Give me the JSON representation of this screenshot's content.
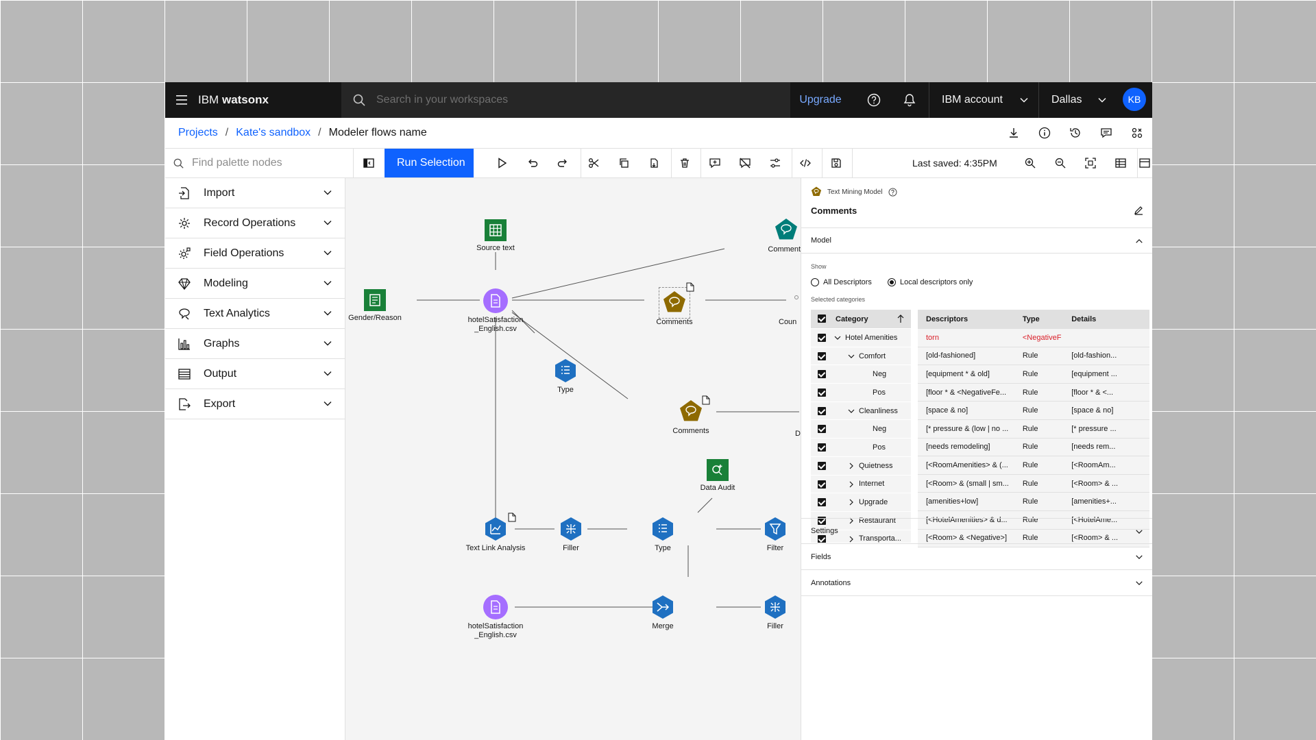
{
  "header": {
    "brand_prefix": "IBM",
    "brand_name": "watsonx",
    "search_placeholder": "Search in your workspaces",
    "upgrade_label": "Upgrade",
    "account_label": "IBM account",
    "region_label": "Dallas",
    "avatar_initials": "KB"
  },
  "breadcrumb": {
    "items": [
      "Projects",
      "Kate's sandbox"
    ],
    "current": "Modeler flows name"
  },
  "toolbar": {
    "palette_search_placeholder": "Find palette nodes",
    "run_selection_label": "Run Selection",
    "last_saved": "Last saved: 4:35PM"
  },
  "palette": {
    "items": [
      {
        "label": "Import",
        "icon": "import-icon"
      },
      {
        "label": "Record Operations",
        "icon": "record-operations-icon"
      },
      {
        "label": "Field Operations",
        "icon": "field-operations-icon"
      },
      {
        "label": "Modeling",
        "icon": "modeling-icon"
      },
      {
        "label": "Text Analytics",
        "icon": "text-analytics-icon"
      },
      {
        "label": "Graphs",
        "icon": "graphs-icon"
      },
      {
        "label": "Output",
        "icon": "output-icon"
      },
      {
        "label": "Export",
        "icon": "export-icon"
      }
    ]
  },
  "canvas": {
    "nodes": {
      "source_text": "Source text",
      "gender_reason": "Gender/Reason",
      "hotel_csv_1_line1": "hotelSatisfaction",
      "hotel_csv_1_line2": "_English.csv",
      "comments_top": "Comments",
      "comments_mid": "Comments",
      "comments_cut": "Coun",
      "type_top": "Type",
      "comments_lower": "Comments",
      "lower_cut": "D",
      "data_audit": "Data Audit",
      "text_link_analysis": "Text Link Analysis",
      "filler_1": "Filler",
      "type_bottom": "Type",
      "filter": "Filter",
      "hotel_csv_2_line1": "hotelSatisfaction",
      "hotel_csv_2_line2": "_English.csv",
      "merge": "Merge",
      "filler_2": "Filler"
    },
    "colors": {
      "green": "#198038",
      "purple": "#a56eff",
      "blue": "#0f62fe",
      "dark_blue": "#1f70c1",
      "teal": "#007d79",
      "gold": "#8e6a00"
    }
  },
  "panel": {
    "node_kind": "Text Mining Model",
    "node_title": "Comments",
    "model_section": "Model",
    "show_label": "Show",
    "radio_all": "All Descriptors",
    "radio_local": "Local descriptors only",
    "selected_categories_label": "Selected categories",
    "tree_header": "Category",
    "tree": [
      {
        "label": "Hotel Amenities",
        "level": 0,
        "chev": "down"
      },
      {
        "label": "Comfort",
        "level": 1,
        "chev": "down"
      },
      {
        "label": "Neg",
        "level": 2,
        "chev": ""
      },
      {
        "label": "Pos",
        "level": 2,
        "chev": ""
      },
      {
        "label": "Cleanliness",
        "level": 1,
        "chev": "down"
      },
      {
        "label": "Neg",
        "level": 2,
        "chev": ""
      },
      {
        "label": "Pos",
        "level": 2,
        "chev": ""
      },
      {
        "label": "Quietness",
        "level": 1,
        "chev": "right"
      },
      {
        "label": "Internet",
        "level": 1,
        "chev": "right"
      },
      {
        "label": "Upgrade",
        "level": 1,
        "chev": "right"
      },
      {
        "label": "Restaurant",
        "level": 1,
        "chev": "right"
      },
      {
        "label": "Transporta...",
        "level": 1,
        "chev": "right"
      }
    ],
    "descriptors_header": {
      "c1": "Descriptors",
      "c2": "Type",
      "c3": "Details"
    },
    "descriptors": [
      {
        "c1": "torn",
        "c2": "<NegativeF",
        "c3": ""
      },
      {
        "c1": "[old-fashioned]",
        "c2": "Rule",
        "c3": "[old-fashion..."
      },
      {
        "c1": "[equipment * & old]",
        "c2": "Rule",
        "c3": "[equipment ..."
      },
      {
        "c1": "[floor * & <NegativeFe...",
        "c2": "Rule",
        "c3": "[floor * & <..."
      },
      {
        "c1": "[space & no]",
        "c2": "Rule",
        "c3": "[space & no]"
      },
      {
        "c1": "[* pressure & (low | no ...",
        "c2": "Rule",
        "c3": "[* pressure ..."
      },
      {
        "c1": "[needs remodeling]",
        "c2": "Rule",
        "c3": "[needs rem..."
      },
      {
        "c1": "[<RoomAmenities> & (...",
        "c2": "Rule",
        "c3": "[<RoomAm..."
      },
      {
        "c1": "[<Room> & (small | sm...",
        "c2": "Rule",
        "c3": "[<Room> & ..."
      },
      {
        "c1": "[amenities+low]",
        "c2": "Rule",
        "c3": "[amenities+..."
      },
      {
        "c1": "[<HotelAmenities> & d...",
        "c2": "Rule",
        "c3": "[<HotelAme..."
      },
      {
        "c1": "[<Room> & <Negative>]",
        "c2": "Rule",
        "c3": "[<Room> & ..."
      }
    ],
    "sections": [
      "Settings",
      "Fields",
      "Annotations"
    ]
  }
}
